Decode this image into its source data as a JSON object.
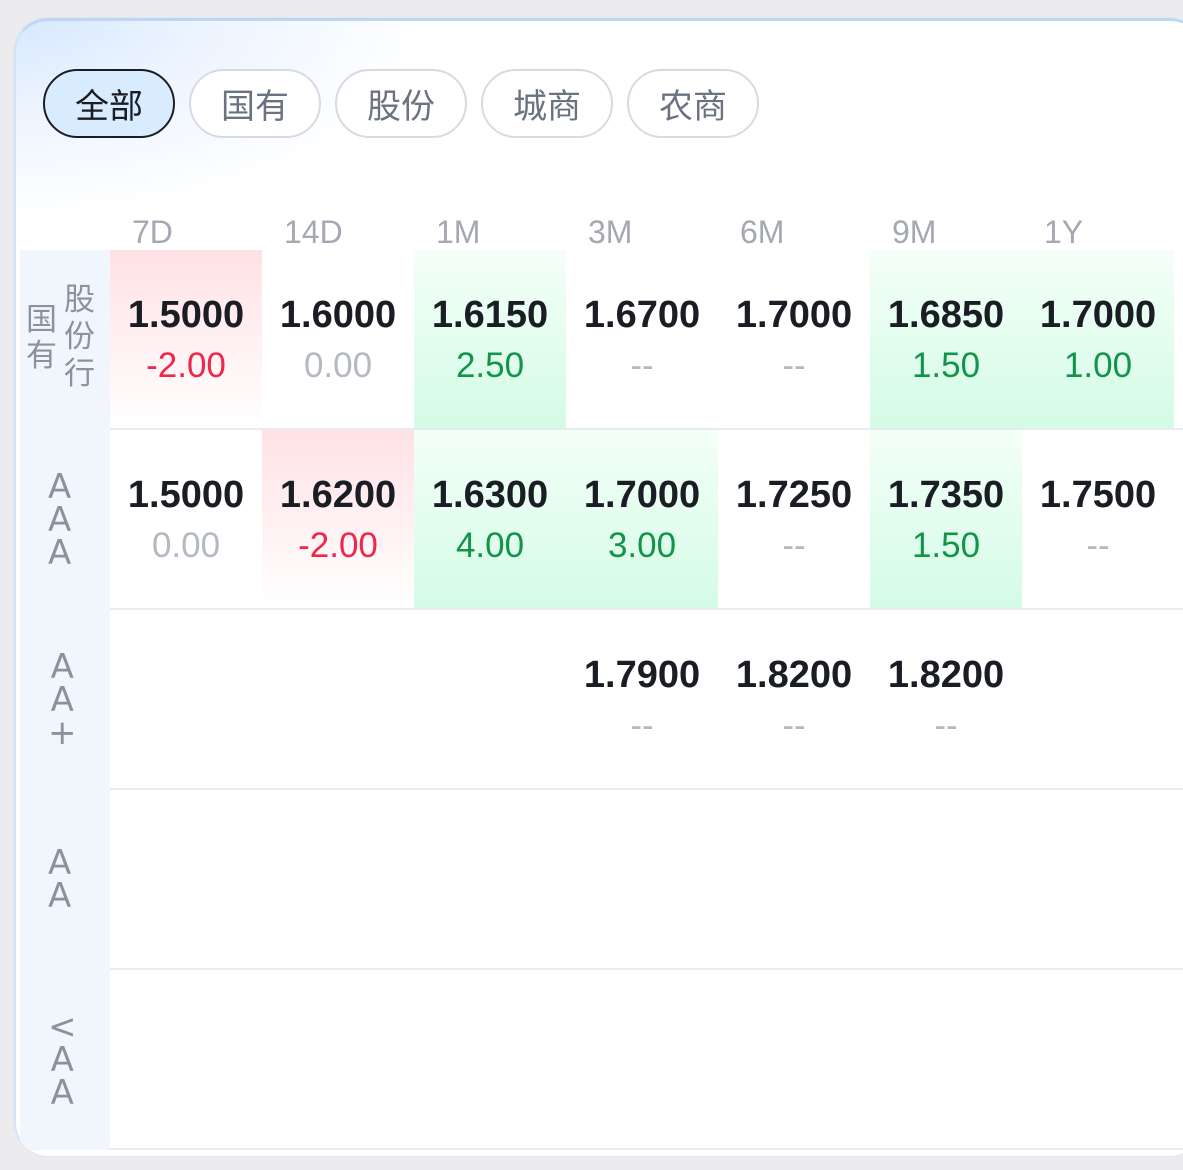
{
  "filters": [
    {
      "label": "全部",
      "active": true
    },
    {
      "label": "国有",
      "active": false
    },
    {
      "label": "股份",
      "active": false
    },
    {
      "label": "城商",
      "active": false
    },
    {
      "label": "农商",
      "active": false
    }
  ],
  "columns": [
    "7D",
    "14D",
    "1M",
    "3M",
    "6M",
    "9M",
    "1Y"
  ],
  "rows": [
    {
      "label_col1": [
        "国",
        "有"
      ],
      "label_col2": [
        "股",
        "份",
        "行"
      ],
      "cells": [
        {
          "rate": "1.5000",
          "change": "-2.00",
          "trend": "up"
        },
        {
          "rate": "1.6000",
          "change": "0.00",
          "trend": "flat"
        },
        {
          "rate": "1.6150",
          "change": "2.50",
          "trend": "down"
        },
        {
          "rate": "1.6700",
          "change": "--",
          "trend": "none"
        },
        {
          "rate": "1.7000",
          "change": "--",
          "trend": "none"
        },
        {
          "rate": "1.6850",
          "change": "1.50",
          "trend": "down"
        },
        {
          "rate": "1.7000",
          "change": "1.00",
          "trend": "down"
        }
      ]
    },
    {
      "label": [
        "A",
        "A",
        "A"
      ],
      "cells": [
        {
          "rate": "1.5000",
          "change": "0.00",
          "trend": "flat"
        },
        {
          "rate": "1.6200",
          "change": "-2.00",
          "trend": "up"
        },
        {
          "rate": "1.6300",
          "change": "4.00",
          "trend": "down"
        },
        {
          "rate": "1.7000",
          "change": "3.00",
          "trend": "down"
        },
        {
          "rate": "1.7250",
          "change": "--",
          "trend": "none"
        },
        {
          "rate": "1.7350",
          "change": "1.50",
          "trend": "down"
        },
        {
          "rate": "1.7500",
          "change": "--",
          "trend": "none"
        }
      ]
    },
    {
      "label": [
        "A",
        "A",
        "+"
      ],
      "cells": [
        {
          "rate": "",
          "change": "",
          "trend": "none"
        },
        {
          "rate": "",
          "change": "",
          "trend": "none"
        },
        {
          "rate": "",
          "change": "",
          "trend": "none"
        },
        {
          "rate": "1.7900",
          "change": "--",
          "trend": "none"
        },
        {
          "rate": "1.8200",
          "change": "--",
          "trend": "none"
        },
        {
          "rate": "1.8200",
          "change": "--",
          "trend": "none"
        },
        {
          "rate": "",
          "change": "",
          "trend": "none"
        }
      ]
    },
    {
      "label": [
        "A",
        "A"
      ],
      "cells": []
    },
    {
      "label": [
        "<",
        "A",
        "A"
      ],
      "cells": []
    }
  ],
  "colors": {
    "up": "#f0274a",
    "down": "#12954a",
    "flat": "#b4b9c1",
    "active_chip_bg": "#d9ecff",
    "label_column_bg": "#f1f6fd"
  }
}
